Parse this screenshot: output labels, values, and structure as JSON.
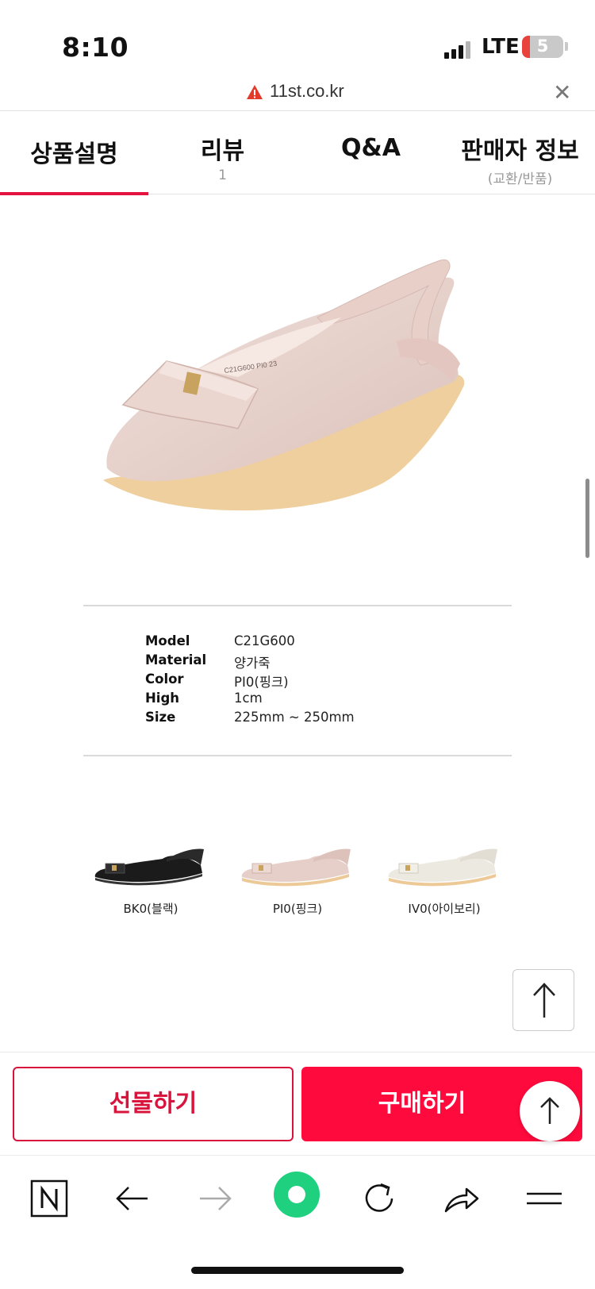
{
  "status_bar": {
    "time": "8:10",
    "network": "LTE",
    "battery": "5"
  },
  "browser": {
    "url": "11st.co.kr",
    "warning_icon": "warning-triangle-icon",
    "close_icon": "close-icon"
  },
  "tabs": [
    {
      "label": "상품설명",
      "sub": "",
      "active": true
    },
    {
      "label": "리뷰",
      "sub": "1",
      "active": false
    },
    {
      "label": "Q&A",
      "sub": "",
      "active": false
    },
    {
      "label": "판매자 정보",
      "sub": "(교환/반품)",
      "active": false
    }
  ],
  "product_image": {
    "stamp": "C21G600 PI0 23"
  },
  "specs": [
    {
      "key": "Model",
      "value": "C21G600"
    },
    {
      "key": "Material",
      "value": "양가죽"
    },
    {
      "key": "Color",
      "value": "PI0(핑크)"
    },
    {
      "key": "High",
      "value": "1cm"
    },
    {
      "key": "Size",
      "value": "225mm ~ 250mm"
    }
  ],
  "variants": [
    {
      "label": "BK0(블랙)",
      "color": "#1b1b1b"
    },
    {
      "label": "PI0(핑크)",
      "color": "#e7cfc9"
    },
    {
      "label": "IV0(아이보리)",
      "color": "#ece9e1"
    }
  ],
  "actions": {
    "gift": "선물하기",
    "buy": "구매하기"
  },
  "colors": {
    "accent": "#ff0a3c",
    "tab_underline": "#e3123f",
    "gift_border": "#d8143d"
  },
  "nav_icons": [
    "n-icon",
    "back-arrow-icon",
    "forward-arrow-icon",
    "green-dot-icon",
    "refresh-icon",
    "share-icon",
    "menu-icon"
  ]
}
